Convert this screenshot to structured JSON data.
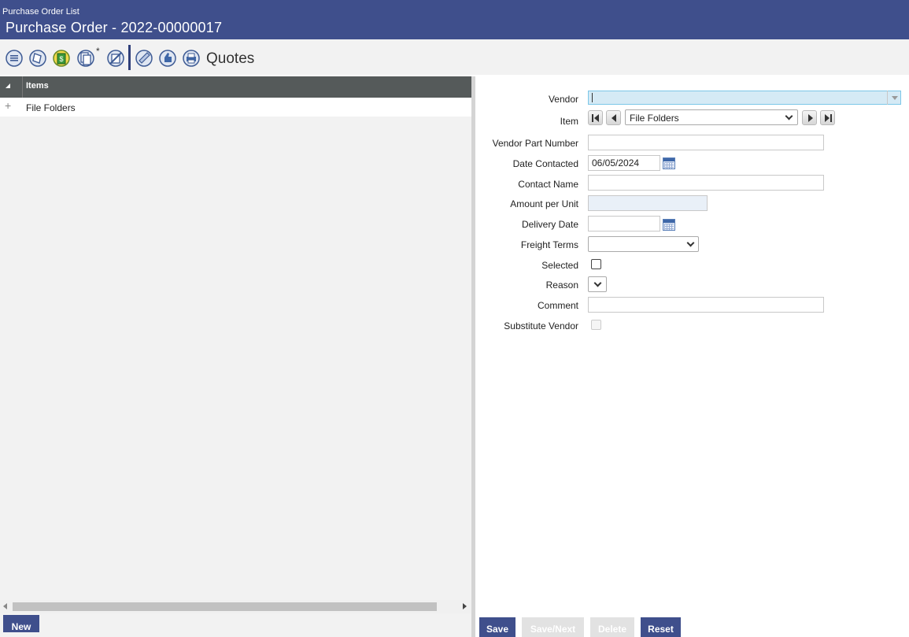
{
  "header": {
    "breadcrumb": "Purchase Order List",
    "title": "Purchase Order - 2022-00000017"
  },
  "toolbar": {
    "icons": [
      "list-icon",
      "document-icon",
      "money-icon",
      "copy-icon",
      "cancel-icon",
      "approve-icon",
      "thumb-icon",
      "print-icon"
    ],
    "star": "*",
    "label": "Quotes"
  },
  "grid": {
    "column_header": "Items",
    "rows": [
      {
        "expand": "+",
        "name": "File Folders"
      }
    ]
  },
  "left_footer": {
    "new_label": "New"
  },
  "form": {
    "vendor": {
      "label": "Vendor",
      "value": ""
    },
    "item": {
      "label": "Item",
      "value": "File Folders"
    },
    "vendor_part_number": {
      "label": "Vendor Part Number",
      "value": ""
    },
    "date_contacted": {
      "label": "Date Contacted",
      "value": "06/05/2024"
    },
    "contact_name": {
      "label": "Contact Name",
      "value": ""
    },
    "amount_per_unit": {
      "label": "Amount per Unit",
      "value": ""
    },
    "delivery_date": {
      "label": "Delivery Date",
      "value": ""
    },
    "freight_terms": {
      "label": "Freight Terms",
      "value": ""
    },
    "selected": {
      "label": "Selected",
      "checked": false
    },
    "reason": {
      "label": "Reason",
      "value": ""
    },
    "comment": {
      "label": "Comment",
      "value": ""
    },
    "substitute_vendor": {
      "label": "Substitute Vendor",
      "checked": false,
      "disabled": true
    }
  },
  "actions": {
    "save": "Save",
    "save_next": "Save/Next",
    "delete": "Delete",
    "reset": "Reset"
  },
  "colors": {
    "header_bg": "#3f4f8c",
    "grid_header_bg": "#555a5a",
    "vendor_focus_bg": "#d5eaf5"
  }
}
